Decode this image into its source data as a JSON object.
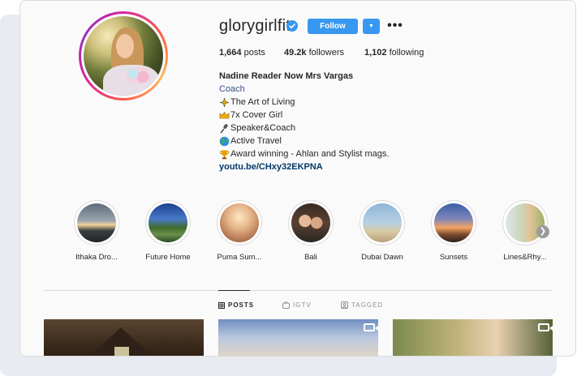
{
  "profile": {
    "username": "glorygirlfit",
    "verified": true,
    "follow_label": "Follow",
    "dropdown_glyph": "▼",
    "more_glyph": "•••",
    "stats": {
      "posts_count": "1,664",
      "posts_label": "posts",
      "followers_count": "49.2k",
      "followers_label": "followers",
      "following_count": "1,102",
      "following_label": "following"
    },
    "bio": {
      "name": "Nadine Reader Now Mrs Vargas",
      "category": "Coach",
      "lines": [
        {
          "icon": "sparkle-icon",
          "text": "The Art of Living"
        },
        {
          "icon": "crown-icon",
          "text": "7x Cover Girl"
        },
        {
          "icon": "microphone-icon",
          "text": "Speaker&Coach"
        },
        {
          "icon": "globe-icon",
          "text": "Active Travel"
        },
        {
          "icon": "trophy-icon",
          "text": "Award winning - Ahlan and Stylist mags."
        }
      ],
      "link": "youtu.be/CHxy32EKPNA"
    }
  },
  "highlights": [
    {
      "label": "Ithaka Dro..."
    },
    {
      "label": "Future Home"
    },
    {
      "label": "Puma Sum..."
    },
    {
      "label": "Bali"
    },
    {
      "label": "Dubai Dawn"
    },
    {
      "label": "Sunsets"
    },
    {
      "label": "Lines&Rhy..."
    }
  ],
  "tabs": [
    {
      "label": "POSTS",
      "icon": "grid-icon",
      "active": true
    },
    {
      "label": "IGTV",
      "icon": "tv-icon",
      "active": false
    },
    {
      "label": "TAGGED",
      "icon": "tag-icon",
      "active": false
    }
  ],
  "colors": {
    "follow_button": "#3897f0",
    "link": "#00376b",
    "category": "#385185",
    "verified_badge": "#3897f0"
  }
}
